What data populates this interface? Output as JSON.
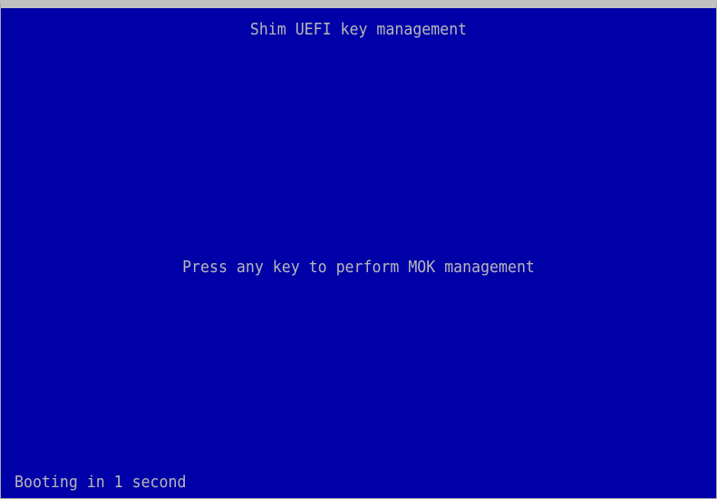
{
  "screen": {
    "title": "Shim UEFI key management",
    "prompt": "Press any key to perform MOK management",
    "status": "Booting in 1 second",
    "colors": {
      "background": "#0000a8",
      "text": "#b8b8b8",
      "frame": "#c0c0c0"
    }
  }
}
